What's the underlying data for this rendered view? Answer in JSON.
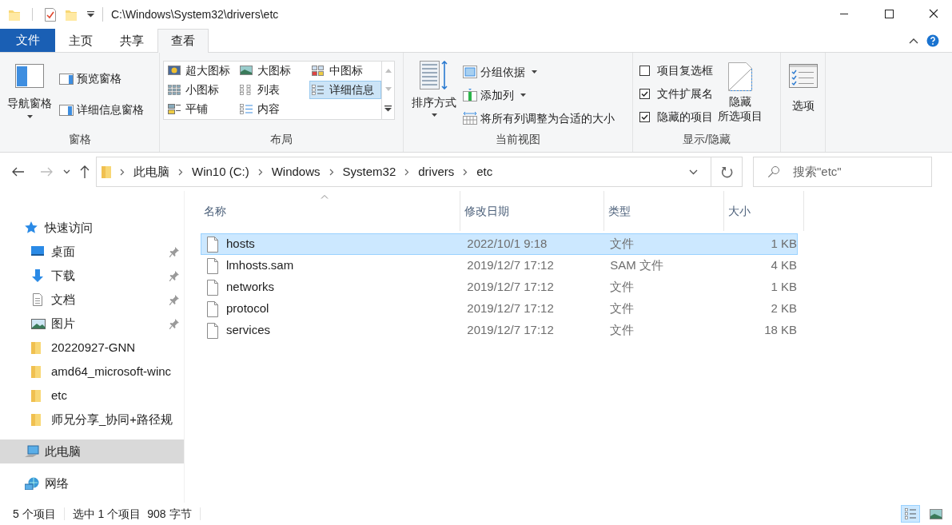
{
  "title_bar": {
    "path": "C:\\Windows\\System32\\drivers\\etc"
  },
  "tabs": [
    {
      "label": "文件",
      "kind": "file",
      "selected": false
    },
    {
      "label": "主页",
      "kind": "tab",
      "selected": false
    },
    {
      "label": "共享",
      "kind": "tab",
      "selected": false
    },
    {
      "label": "查看",
      "kind": "tab",
      "selected": true
    }
  ],
  "ribbon": {
    "panes": {
      "label": "窗格",
      "big": "导航窗格",
      "items": [
        "预览窗格",
        "详细信息窗格"
      ]
    },
    "layout": {
      "label": "布局",
      "options": [
        {
          "label": "超大图标",
          "selected": false
        },
        {
          "label": "大图标",
          "selected": false
        },
        {
          "label": "中图标",
          "selected": false
        },
        {
          "label": "小图标",
          "selected": false
        },
        {
          "label": "列表",
          "selected": false
        },
        {
          "label": "详细信息",
          "selected": true
        },
        {
          "label": "平铺",
          "selected": false
        },
        {
          "label": "内容",
          "selected": false
        }
      ]
    },
    "current_view": {
      "label": "当前视图",
      "big": "排序方式",
      "items": [
        {
          "label": "分组依据",
          "dropdown": true
        },
        {
          "label": "添加列",
          "dropdown": true
        },
        {
          "label": "将所有列调整为合适的大小",
          "dropdown": false
        }
      ]
    },
    "show_hide": {
      "label": "显示/隐藏",
      "checkboxes": [
        {
          "label": "项目复选框",
          "checked": false
        },
        {
          "label": "文件扩展名",
          "checked": true
        },
        {
          "label": "隐藏的项目",
          "checked": true
        }
      ],
      "big": [
        "隐藏",
        "所选项目"
      ]
    },
    "options": {
      "label": "选项"
    }
  },
  "address_bar": {
    "crumbs": [
      "此电脑",
      "Win10 (C:)",
      "Windows",
      "System32",
      "drivers",
      "etc"
    ]
  },
  "search": {
    "placeholder": "搜索\"etc\""
  },
  "sidebar": {
    "items": [
      {
        "label": "快速访问",
        "kind": "star",
        "pinned": false,
        "selected": false,
        "children": [
          {
            "label": "桌面",
            "kind": "desktop",
            "pinned": true,
            "selected": false
          },
          {
            "label": "下载",
            "kind": "download",
            "pinned": true,
            "selected": false
          },
          {
            "label": "文档",
            "kind": "document",
            "pinned": true,
            "selected": false
          },
          {
            "label": "图片",
            "kind": "pictures",
            "pinned": true,
            "selected": false
          },
          {
            "label": "20220927-GNN",
            "kind": "folder",
            "pinned": false,
            "selected": false
          },
          {
            "label": "amd64_microsoft-winc",
            "kind": "folder",
            "pinned": false,
            "selected": false
          },
          {
            "label": "etc",
            "kind": "folder",
            "pinned": false,
            "selected": false
          },
          {
            "label": "师兄分享_协同+路径规",
            "kind": "folder",
            "pinned": false,
            "selected": false
          }
        ]
      },
      {
        "label": "此电脑",
        "kind": "pc",
        "pinned": false,
        "selected": true
      },
      {
        "label": "网络",
        "kind": "network",
        "pinned": false,
        "selected": false
      }
    ]
  },
  "table": {
    "columns": [
      "名称",
      "修改日期",
      "类型",
      "大小"
    ],
    "rows": [
      {
        "name": "hosts",
        "modified": "2022/10/1 9:18",
        "type": "文件",
        "size": "1 KB",
        "selected": true
      },
      {
        "name": "lmhosts.sam",
        "modified": "2019/12/7 17:12",
        "type": "SAM 文件",
        "size": "4 KB",
        "selected": false
      },
      {
        "name": "networks",
        "modified": "2019/12/7 17:12",
        "type": "文件",
        "size": "1 KB",
        "selected": false
      },
      {
        "name": "protocol",
        "modified": "2019/12/7 17:12",
        "type": "文件",
        "size": "2 KB",
        "selected": false
      },
      {
        "name": "services",
        "modified": "2019/12/7 17:12",
        "type": "文件",
        "size": "18 KB",
        "selected": false
      }
    ]
  },
  "status_bar": {
    "count": "5 个项目",
    "selection": "选中 1 个项目",
    "size": "908 字节"
  },
  "view_toggles": [
    {
      "kind": "details",
      "selected": true
    },
    {
      "kind": "large_icons",
      "selected": false
    }
  ]
}
